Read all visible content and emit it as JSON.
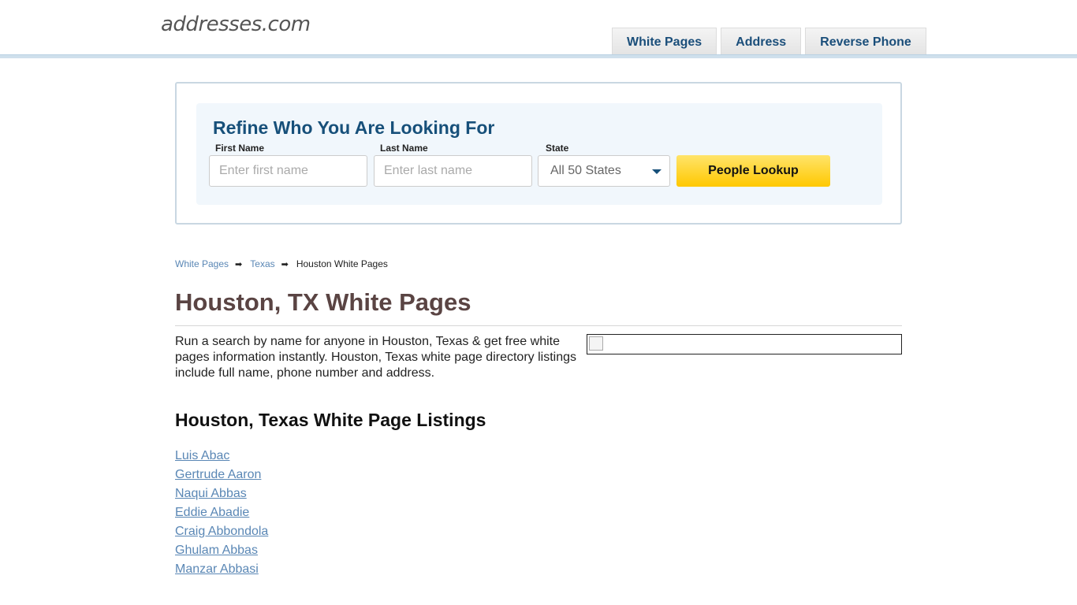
{
  "header": {
    "logo": "addresses.com",
    "nav": [
      {
        "label": "White Pages"
      },
      {
        "label": "Address"
      },
      {
        "label": "Reverse Phone"
      }
    ]
  },
  "search": {
    "title": "Refine Who You Are Looking For",
    "first_name_label": "First Name",
    "first_name_placeholder": "Enter first name",
    "last_name_label": "Last Name",
    "last_name_placeholder": "Enter last name",
    "state_label": "State",
    "state_selected": "All 50 States",
    "button_label": "People Lookup"
  },
  "breadcrumb": {
    "items": [
      {
        "label": "White Pages"
      },
      {
        "label": "Texas"
      }
    ],
    "current": "Houston White Pages"
  },
  "main": {
    "title": "Houston, TX White Pages",
    "intro": "Run a search by name for anyone in Houston, Texas & get free white pages information instantly. Houston, Texas white page directory listings include full name, phone number and address.",
    "listings_heading": "Houston, Texas White Page Listings",
    "listings": [
      "Luis Abac",
      "Gertrude Aaron",
      "Naqui Abbas",
      "Eddie Abadie",
      "Craig Abbondola",
      "Ghulam Abbas",
      "Manzar Abbasi"
    ]
  },
  "colors": {
    "link": "#5a87b5",
    "nav_text": "#1a4e7a",
    "title": "#5a4443",
    "button": "#ffc800"
  }
}
